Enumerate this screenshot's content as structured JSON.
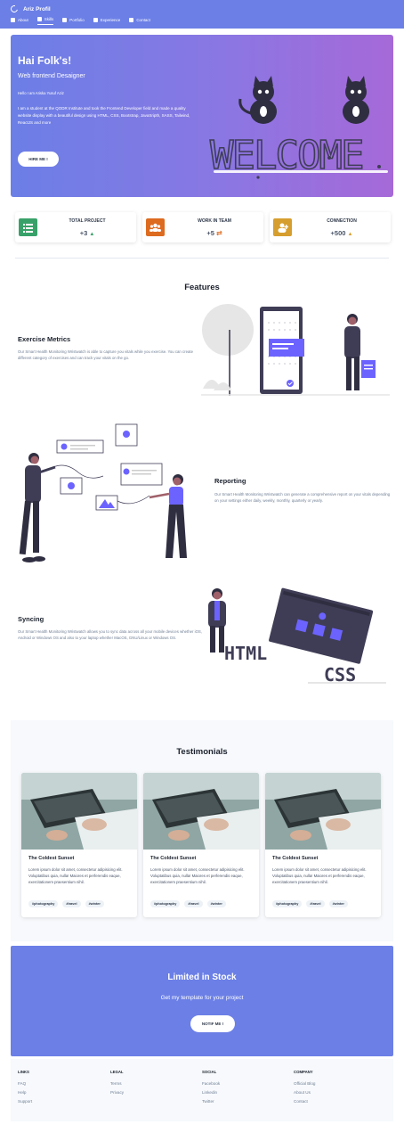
{
  "navbar": {
    "brand": "Ariz Profil",
    "items": [
      {
        "label": "About",
        "icon": "home-icon"
      },
      {
        "label": "Skills",
        "icon": "list-icon"
      },
      {
        "label": "Portfolio",
        "icon": "picture-icon"
      },
      {
        "label": "Experience",
        "icon": "folder-icon"
      },
      {
        "label": "Contact",
        "icon": "mail-icon"
      }
    ],
    "active": "Skills",
    "color": "#6b7fe6"
  },
  "hero": {
    "title": "Hai Folk's!",
    "subtitle": "Web frontend Desaigner",
    "hello": "Hello I am Ariska Yusuf Aziz",
    "description": "I am a student at the QODR Institute and took the Frontend Developer field and made a quality website display with a beautiful design using HTML, CSS, Bootstrap, JavaSripth, SASS, Tailwind, ReactJS and more",
    "button": "HIRE ME !",
    "art_text": "WELCOME"
  },
  "stats": [
    {
      "label": "TOTAL PROJECT",
      "value": "+3",
      "trend": "up",
      "icon": "list-icon",
      "color": "#38a169"
    },
    {
      "label": "WORK IN TEAM",
      "value": "+5",
      "trend": "swap",
      "icon": "users-icon",
      "color": "#dd6b20"
    },
    {
      "label": "CONNECTION",
      "value": "+500",
      "trend": "up",
      "icon": "user-plus-icon",
      "color": "#d69e2e"
    }
  ],
  "features": {
    "title": "Features",
    "items": [
      {
        "title": "Exercise Metrics",
        "description": "Our Smart Health Monitoring Wristwatch is able to capture you vitals while you exercise. You can create different category of exercises and can track your vitals on the go."
      },
      {
        "title": "Reporting",
        "description": "Our Smart Health Monitoring Wristwatch can generate a comprehensive report on your vitals depending on your settings either daily, weekly, monthly, quarterly or yearly."
      },
      {
        "title": "Syncing",
        "description": "Our Smart Health Monitoring Wristwatch allows you to sync data across all your mobile devices whether iOS, Android or Windows OS and also to your laptop whether MacOS, GNU/Linux or Windows OS."
      }
    ],
    "art_labels": [
      "HTML",
      "CSS"
    ]
  },
  "testimonials": {
    "title": "Testimonials",
    "cards": [
      {
        "title": "The Coldest Sunset",
        "text": "Lorem ipsum dolor sit amet, consectetur adipisicing elit. Voluptatibus quia, nulla! Maiores et perferendis eaque, exercitationem praesentium nihil.",
        "tags": [
          "#photography",
          "#travel",
          "#winter"
        ]
      },
      {
        "title": "The Coldest Sunset",
        "text": "Lorem ipsum dolor sit amet, consectetur adipisicing elit. Voluptatibus quia, nulla! Maiores et perferendis eaque, exercitationem praesentium nihil.",
        "tags": [
          "#photography",
          "#travel",
          "#winter"
        ]
      },
      {
        "title": "The Coldest Sunset",
        "text": "Lorem ipsum dolor sit amet, consectetur adipisicing elit. Voluptatibus quia, nulla! Maiores et perferendis eaque, exercitationem praesentium nihil.",
        "tags": [
          "#photography",
          "#travel",
          "#winter"
        ]
      }
    ]
  },
  "cta": {
    "title": "Limited in Stock",
    "subtitle": "Get my template for your project",
    "button": "NOTIF ME !"
  },
  "footer": {
    "columns": [
      {
        "heading": "LINKS",
        "links": [
          "FAQ",
          "Help",
          "Support"
        ]
      },
      {
        "heading": "LEGAL",
        "links": [
          "Terms",
          "Privacy"
        ]
      },
      {
        "heading": "SOCIAL",
        "links": [
          "Facebook",
          "Linkedin",
          "Twitter"
        ]
      },
      {
        "heading": "COMPANY",
        "links": [
          "Official Blog",
          "About Us",
          "Contact"
        ]
      }
    ]
  }
}
